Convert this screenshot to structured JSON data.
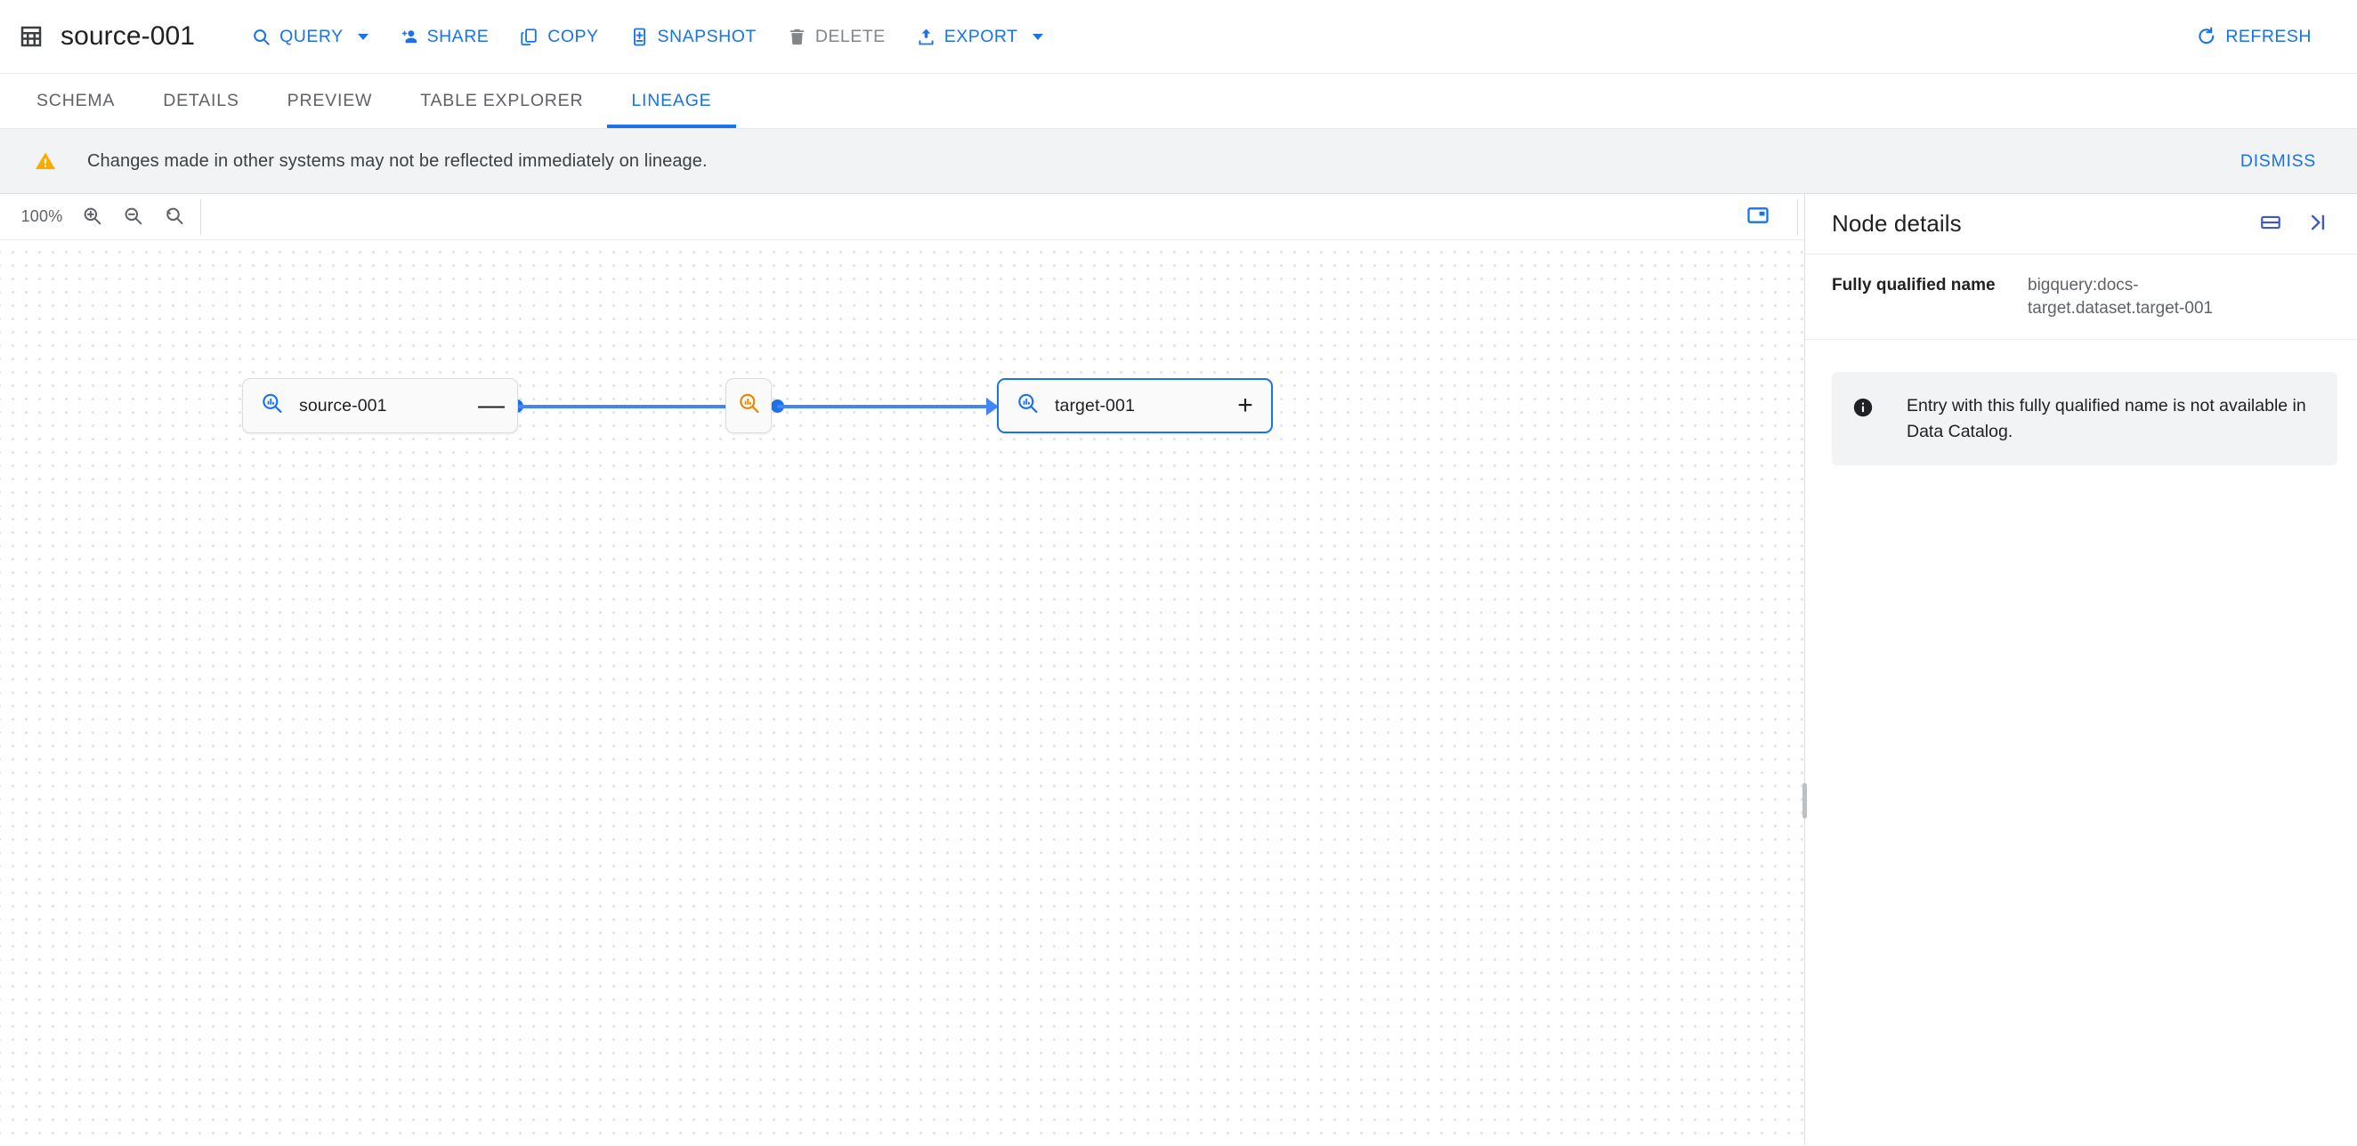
{
  "appbar": {
    "table_icon": "table-grid-icon",
    "title": "source-001",
    "actions": [
      {
        "label": "QUERY",
        "icon": "search-icon",
        "has_caret": true,
        "disabled": false
      },
      {
        "label": "SHARE",
        "icon": "person-add-icon",
        "has_caret": false,
        "disabled": false
      },
      {
        "label": "COPY",
        "icon": "copy-icon",
        "has_caret": false,
        "disabled": false
      },
      {
        "label": "SNAPSHOT",
        "icon": "snapshot-icon",
        "has_caret": false,
        "disabled": false
      },
      {
        "label": "DELETE",
        "icon": "trash-icon",
        "has_caret": false,
        "disabled": true
      },
      {
        "label": "EXPORT",
        "icon": "export-upload-icon",
        "has_caret": true,
        "disabled": false
      }
    ],
    "refresh_label": "REFRESH",
    "refresh_icon": "refresh-icon",
    "accent_color": "#1a73e8",
    "disabled_color": "#80868b"
  },
  "tabs": [
    {
      "label": "SCHEMA",
      "active": false
    },
    {
      "label": "DETAILS",
      "active": false
    },
    {
      "label": "PREVIEW",
      "active": false
    },
    {
      "label": "TABLE EXPLORER",
      "active": false
    },
    {
      "label": "LINEAGE",
      "active": true
    }
  ],
  "banner": {
    "icon": "warning-triangle-icon",
    "icon_color": "#f9ab00",
    "message": "Changes made in other systems may not be reflected immediately on lineage.",
    "dismiss_label": "DISMISS"
  },
  "graph_toolbar": {
    "zoom_level": "100%",
    "zoom_in_icon": "zoom-in-icon",
    "zoom_out_icon": "zoom-out-icon",
    "zoom_reset_icon": "zoom-reset-icon",
    "minimap_icon": "minimap-toggle-icon",
    "minimap_color": "#1a73e8"
  },
  "graph": {
    "nodes": [
      {
        "id": "source-001",
        "type": "table",
        "label": "source-001",
        "icon": "bigquery-table-search-icon",
        "icon_color": "#1a73e8",
        "toggle": "—",
        "toggle_name": "collapse-button",
        "selected": false
      },
      {
        "id": "process",
        "type": "process",
        "label": "",
        "icon": "dataflow-process-search-icon",
        "icon_color": "#ea8600",
        "selected": false
      },
      {
        "id": "target-001",
        "type": "table",
        "label": "target-001",
        "icon": "bigquery-table-search-icon",
        "icon_color": "#1a73e8",
        "toggle": "+",
        "toggle_name": "expand-button",
        "selected": true
      }
    ],
    "edge_color": "#4285f4",
    "edges": [
      {
        "from": "source-001",
        "to": "process"
      },
      {
        "from": "process",
        "to": "target-001"
      }
    ]
  },
  "details": {
    "title": "Node details",
    "split_icon": "split-pane-icon",
    "collapse_icon": "collapse-right-icon",
    "rows": [
      {
        "key": "Fully qualified name",
        "value": "bigquery:docs-target.dataset.target-001"
      }
    ],
    "info": {
      "icon": "info-circle-icon",
      "message": "Entry with this fully qualified name is not available in Data Catalog."
    }
  }
}
